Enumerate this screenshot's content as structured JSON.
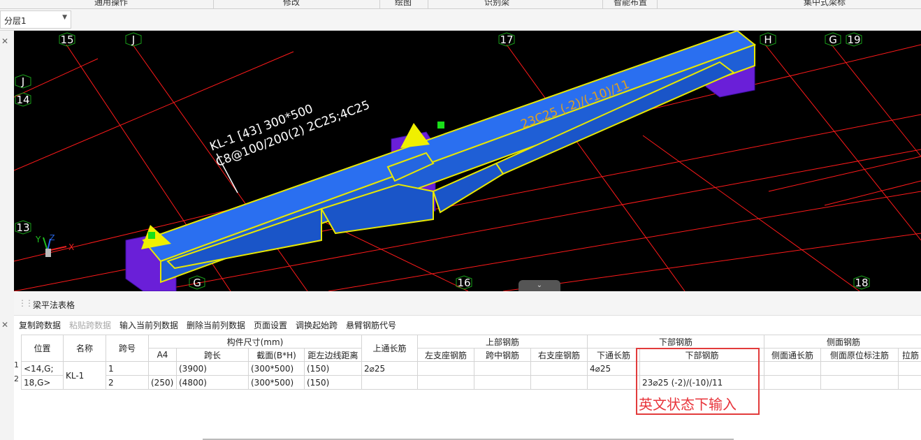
{
  "top_menu": {
    "items": [
      "通用操作",
      "修改",
      "绘图",
      "识别梁",
      "智能布置",
      "集中式梁标"
    ]
  },
  "layer_select": {
    "value": "分层1"
  },
  "axis_labels": {
    "a15": "15",
    "aJ_top": "J",
    "a17": "17",
    "aH": "H",
    "aG_top": "G",
    "a19": "19",
    "aJ_left": "J",
    "a14": "14",
    "a13": "13",
    "aG_bottom": "G",
    "a16": "16",
    "a18": "18"
  },
  "beam_annotation": {
    "line1": "KL-1 [43] 300*500",
    "line2": "C8@100/200(2) 2C25;4C25",
    "bottom_rebar": "23C25 (-2)/(-10)/11"
  },
  "coord_axes": {
    "x": "X",
    "y": "Y",
    "z": "Z"
  },
  "panel": {
    "title": "梁平法表格",
    "toolbar": [
      "复制跨数据",
      "粘贴跨数据",
      "输入当前列数据",
      "删除当前列数据",
      "页面设置",
      "调换起始跨",
      "悬臂钢筋代号"
    ]
  },
  "table": {
    "header1": {
      "position": "位置",
      "name": "名称",
      "span_no": "跨号",
      "member_size": "构件尺寸(mm)",
      "top_through": "上通长筋",
      "top_rebar": "上部钢筋",
      "bottom_rebar": "下部钢筋",
      "side_rebar": "侧面钢筋"
    },
    "header2": {
      "a4": "A4",
      "span_len": "跨长",
      "section": "截面(B*H)",
      "left_dist": "距左边线距离",
      "left_support": "左支座钢筋",
      "mid_span": "跨中钢筋",
      "right_support": "右支座钢筋",
      "bottom_through": "下通长筋",
      "bottom_rebar": "下部钢筋",
      "side_through": "侧面通长筋",
      "side_orig": "侧面原位标注筋",
      "tie": "拉筋"
    },
    "rows": [
      {
        "num": "1",
        "position": "<14,G;",
        "name": "KL-1",
        "span": "1",
        "a4": "",
        "span_len": "(3900)",
        "section": "(300*500)",
        "left_dist": "(150)",
        "top_through": "2⌀25",
        "bottom_through": "4⌀25",
        "bottom_rebar": ""
      },
      {
        "num": "2",
        "position": "18,G>",
        "span": "2",
        "a4": "(250)",
        "span_len": "(4800)",
        "section": "(300*500)",
        "left_dist": "(150)",
        "top_through": "",
        "bottom_through": "",
        "bottom_rebar": "23⌀25 (-2)/(-10)/11"
      }
    ]
  },
  "hint_text": "英文状态下输入",
  "colors": {
    "beam": "#1f5fd6",
    "column": "#6a1fd8",
    "grid_line": "#ff1a1a",
    "highlight": "#e8e800",
    "axis_circle": "#1aa01a",
    "hint": "#e8343b"
  }
}
